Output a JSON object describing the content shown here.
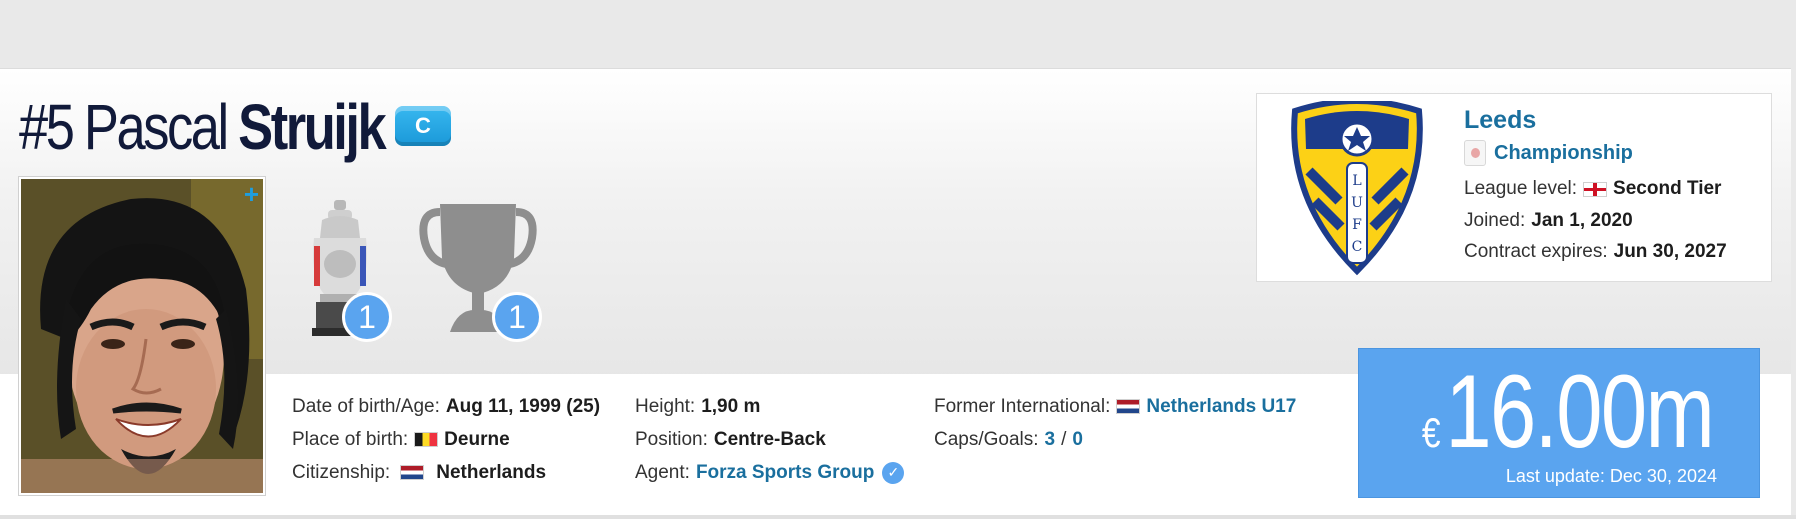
{
  "player": {
    "number": "#5",
    "first_name": "Pascal",
    "last_name": "Struijk",
    "captain_label": "C"
  },
  "trophies": [
    {
      "icon": "championship-trophy-icon",
      "count": "1"
    },
    {
      "icon": "generic-cup-icon",
      "count": "1"
    }
  ],
  "details": {
    "col1": [
      {
        "label": "Date of birth/Age:",
        "value": "Aug 11, 1999 (25)"
      },
      {
        "label": "Place of birth:",
        "value": "Deurne",
        "flag": "belgium"
      },
      {
        "label": "Citizenship:",
        "value": "Netherlands",
        "flag": "netherlands"
      }
    ],
    "col2": [
      {
        "label": "Height:",
        "value": "1,90 m"
      },
      {
        "label": "Position:",
        "value": "Centre-Back"
      },
      {
        "label": "Agent:",
        "value": "Forza Sports Group"
      }
    ],
    "col3": [
      {
        "label": "Former International:",
        "value": "Netherlands U17",
        "flag": "netherlands"
      },
      {
        "label": "Caps/Goals:",
        "caps": "3",
        "separator": "/",
        "goals": "0"
      }
    ]
  },
  "club": {
    "name": "Leeds",
    "league": "Championship",
    "level_label": "League level:",
    "level_value": "Second Tier",
    "joined_label": "Joined:",
    "joined_value": "Jan 1, 2020",
    "contract_label": "Contract expires:",
    "contract_value": "Jun 30, 2027",
    "crest_text": "LUFC"
  },
  "market_value": {
    "currency": "€",
    "amount": "16.00m",
    "last_update": "Last update: Dec 30, 2024"
  },
  "colors": {
    "accent_blue": "#5aa4ef",
    "link_blue": "#1a6f9e",
    "title_navy": "#111a3a",
    "captain_badge": "#1a98d8"
  }
}
